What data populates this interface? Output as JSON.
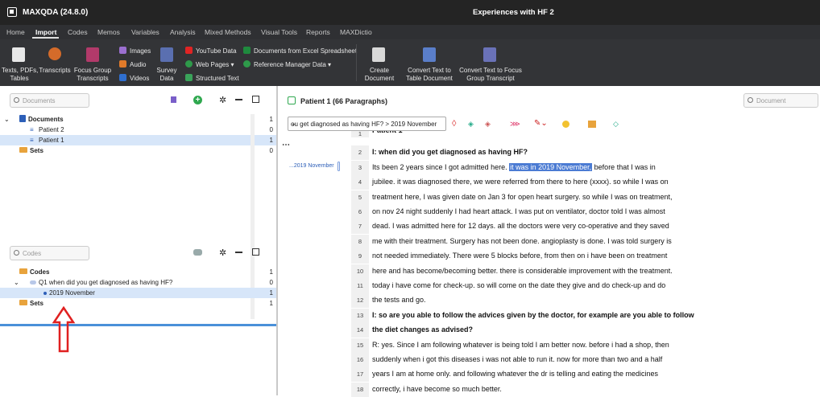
{
  "app": {
    "name": "MAXQDA (24.8.0)",
    "project": "Experiences with HF 2"
  },
  "menu": [
    "Home",
    "Import",
    "Codes",
    "Memos",
    "Variables",
    "Analysis",
    "Mixed Methods",
    "Visual Tools",
    "Reports",
    "MAXDictio"
  ],
  "ribbon": {
    "texts": "Texts, PDFs,\nTables",
    "transcripts": "Transcripts",
    "focus_group": "Focus Group\nTranscripts",
    "images": "Images",
    "audio": "Audio",
    "videos": "Videos",
    "survey": "Survey\nData",
    "youtube": "YouTube Data",
    "web_pages": "Web Pages",
    "structured": "Structured Text",
    "excel": "Documents from Excel Spreadsheet",
    "refmgr": "Reference Manager Data",
    "create_doc": "Create\nDocument",
    "convert_table": "Convert Text to\nTable Document",
    "convert_focus": "Convert Text to Focus\nGroup Transcript"
  },
  "documents_pane": {
    "search_placeholder": "Documents",
    "root": {
      "label": "Documents",
      "count": "1"
    },
    "items": [
      {
        "label": "Patient 2",
        "count": "0"
      },
      {
        "label": "Patient 1",
        "count": "1"
      }
    ],
    "sets": {
      "label": "Sets",
      "count": "0"
    }
  },
  "codes_pane": {
    "search_placeholder": "Codes",
    "root": {
      "label": "Codes",
      "count": "1"
    },
    "q1": {
      "label": "Q1 when did you get diagnosed as having HF?",
      "count": "0"
    },
    "sub": {
      "label": "2019 November",
      "count": "1"
    },
    "sets": {
      "label": "Sets",
      "count": "1"
    }
  },
  "browser": {
    "title": "Patient 1   (66 Paragraphs)",
    "search_placeholder": "Document",
    "combo_value": "ou get diagnosed as having HF? > 2019 November",
    "code_stripe_label": "...2019 November",
    "paragraphs": [
      {
        "n": "1",
        "text": "Patient 1",
        "bold": true
      },
      {
        "n": "2",
        "text": "I: when did you get diagnosed as having HF?",
        "bold": true
      },
      {
        "n": "3",
        "pre": "Its been 2 years since I got admitted here. ",
        "hl": "it was in 2019 November,",
        "post": " before that I was in"
      },
      {
        "n": "4",
        "text": "jubilee. it was diagnosed there, we were referred from there to here (xxxx). so while I was on"
      },
      {
        "n": "5",
        "text": "treatment here, I was given date on Jan 3 for open heart surgery. so while I was on treatment,"
      },
      {
        "n": "6",
        "text": "on nov 24 night suddenly I had heart attack. I was put on ventilator, doctor told I was almost"
      },
      {
        "n": "7",
        "text": "dead. I was admitted here for 12 days. all the doctors were very co-operative and they saved"
      },
      {
        "n": "8",
        "text": "me with their treatment. Surgery has not been done. angioplasty is done. I was told surgery is"
      },
      {
        "n": "9",
        "text": "not needed immediately. There were 5 blocks before, from then on i have been on treatment"
      },
      {
        "n": "10",
        "text": "here and has become/becoming better. there is considerable improvement with the treatment."
      },
      {
        "n": "11",
        "text": "today i have come for check-up. so will come on the date they give and do check-up and do"
      },
      {
        "n": "12",
        "text": "the tests and go."
      },
      {
        "n": "13",
        "text": "I: so are you able to follow the advices given by the doctor, for example are you able to follow",
        "bold": true
      },
      {
        "n": "14",
        "text": "the diet changes as advised?",
        "bold": true
      },
      {
        "n": "15",
        "text": "R: yes. Since I am following whatever is being told I am better now. before i had a shop, then"
      },
      {
        "n": "16",
        "text": "suddenly when i got this diseases i was not able to run it. now for more than two and a half"
      },
      {
        "n": "17",
        "text": "years I am at home only. and following whatever the dr is telling and eating the medicines"
      },
      {
        "n": "18",
        "text": "correctly, i have become so much better."
      }
    ]
  },
  "colors": {
    "accent": "#4a90d9",
    "highlight": "#4b7bd3",
    "folder": "#e8a33c",
    "arrow": "#e02020"
  }
}
